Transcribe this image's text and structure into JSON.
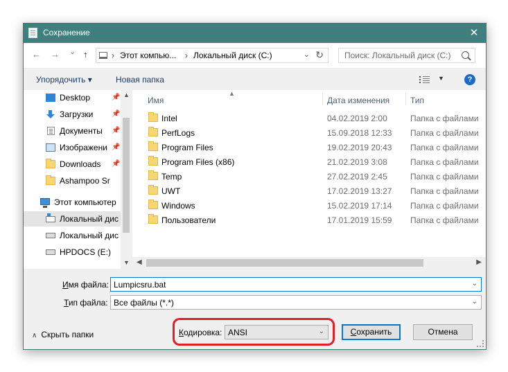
{
  "window": {
    "title": "Сохранение"
  },
  "nav": {
    "back": "←",
    "forward": "→",
    "recent": "⌄",
    "up": "↑",
    "refresh": "↻"
  },
  "address": {
    "sep": "›",
    "parts": [
      "Этот компью...",
      "Локальный диск (C:)"
    ]
  },
  "search": {
    "placeholder": "Поиск: Локальный диск (C:)"
  },
  "toolbar": {
    "organize": "Упорядочить ▾",
    "new_folder": "Новая папка",
    "help": "?"
  },
  "sidebar": {
    "items": [
      {
        "label": "Desktop",
        "icon": "desktop-icon",
        "pinned": true
      },
      {
        "label": "Загрузки",
        "icon": "download-icon",
        "pinned": true
      },
      {
        "label": "Документы",
        "icon": "document-icon",
        "pinned": true
      },
      {
        "label": "Изображени",
        "icon": "image-icon",
        "pinned": true
      },
      {
        "label": "Downloads",
        "icon": "folder-icon",
        "pinned": true
      },
      {
        "label": "Ashampoo Sr",
        "icon": "folder-icon",
        "pinned": false
      },
      {
        "label": "Этот компьютер",
        "icon": "computer-icon",
        "pinned": false
      },
      {
        "label": "Локальный дис",
        "icon": "local-disk-icon",
        "pinned": false,
        "selected": true
      },
      {
        "label": "Локальный дис",
        "icon": "drive-icon",
        "pinned": false
      },
      {
        "label": "HPDOCS (E:)",
        "icon": "drive-icon",
        "pinned": false
      }
    ]
  },
  "files": {
    "columns": {
      "name": "Имя",
      "date": "Дата изменения",
      "type": "Тип"
    },
    "rows": [
      {
        "name": "Intel",
        "date": "04.02.2019 2:00",
        "type": "Папка с файлами"
      },
      {
        "name": "PerfLogs",
        "date": "15.09.2018 12:33",
        "type": "Папка с файлами"
      },
      {
        "name": "Program Files",
        "date": "19.02.2019 20:43",
        "type": "Папка с файлами"
      },
      {
        "name": "Program Files (x86)",
        "date": "21.02.2019 3:08",
        "type": "Папка с файлами"
      },
      {
        "name": "Temp",
        "date": "27.02.2019 2:45",
        "type": "Папка с файлами"
      },
      {
        "name": "UWT",
        "date": "17.02.2019 13:27",
        "type": "Папка с файлами"
      },
      {
        "name": "Windows",
        "date": "15.02.2019 17:14",
        "type": "Папка с файлами"
      },
      {
        "name": "Пользователи",
        "date": "17.01.2019 15:59",
        "type": "Папка с файлами"
      }
    ]
  },
  "form": {
    "filename_label_u": "И",
    "filename_label_rest": "мя файла:",
    "filename_value": "Lumpicsru.bat",
    "filetype_label_u": "Т",
    "filetype_label_rest": "ип файла:",
    "filetype_value": "Все файлы  (*.*)",
    "encoding_label_u": "К",
    "encoding_label_rest": "одировка:",
    "encoding_value": "ANSI",
    "hide_folders": "Скрыть папки",
    "save_u": "С",
    "save_rest": "охранить",
    "cancel": "Отмена"
  },
  "colors": {
    "titlebar": "#3f7f7e",
    "highlight": "#e51e23",
    "accent": "#0078d7"
  }
}
